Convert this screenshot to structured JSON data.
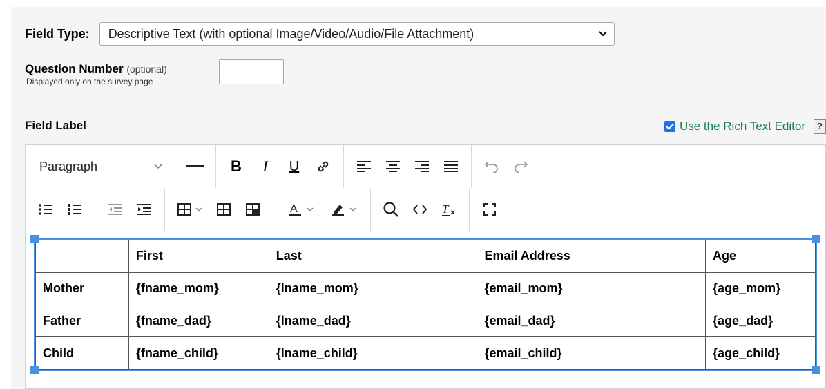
{
  "field_type": {
    "label": "Field Type:",
    "selected": "Descriptive Text (with optional Image/Video/Audio/File Attachment)"
  },
  "question_number": {
    "label": "Question Number",
    "optional": "(optional)",
    "hint": "Displayed only on the survey page",
    "value": ""
  },
  "field_label": {
    "label": "Field Label",
    "rich_text_toggle": "Use the Rich Text Editor",
    "help": "?"
  },
  "toolbar": {
    "block_format": "Paragraph"
  },
  "table": {
    "headers": [
      "",
      "First",
      "Last",
      "Email Address",
      "Age"
    ],
    "rows": [
      [
        "Mother",
        "{fname_mom}",
        "{lname_mom}",
        "{email_mom}",
        "{age_mom}"
      ],
      [
        "Father",
        "{fname_dad}",
        "{lname_dad}",
        "{email_dad}",
        "{age_dad}"
      ],
      [
        "Child",
        "{fname_child}",
        "{lname_child}",
        "{email_child}",
        "{age_child}"
      ]
    ]
  },
  "colors": {
    "accent": "#4a90e2",
    "checkbox": "#1a73e8",
    "toggle_text": "#1a7a5a"
  }
}
